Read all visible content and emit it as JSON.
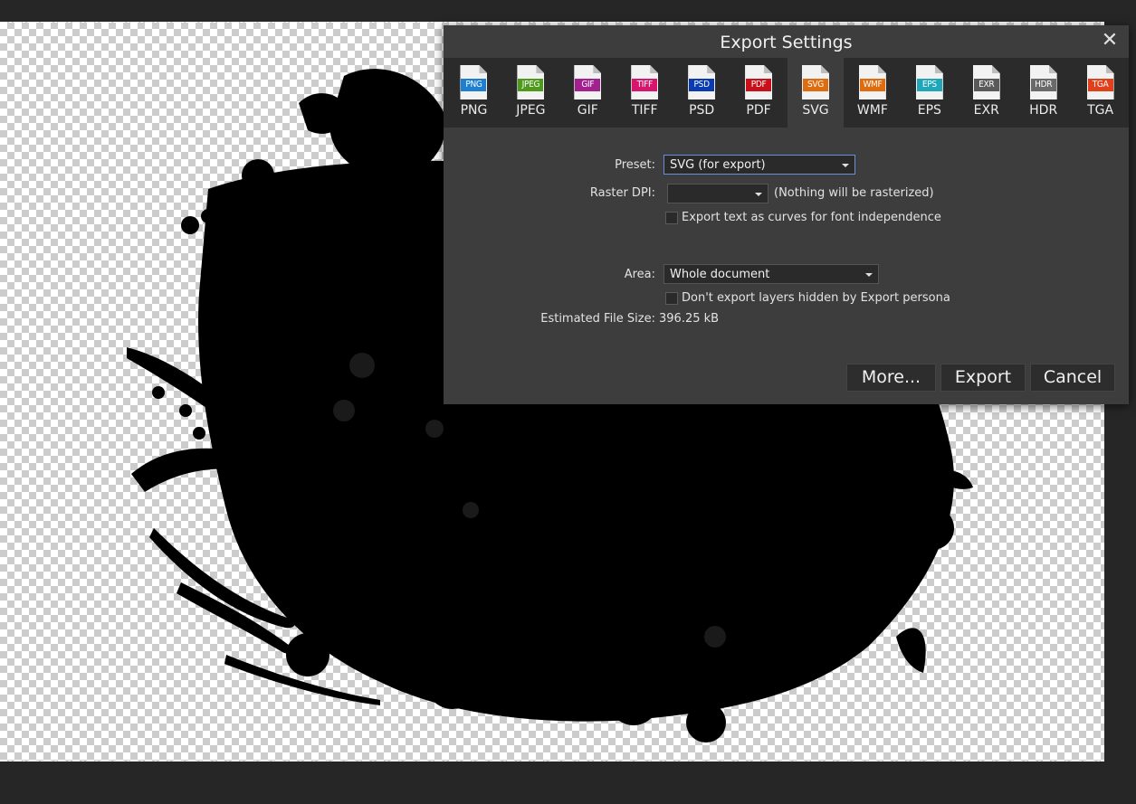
{
  "dialog": {
    "title": "Export Settings",
    "close_glyph": "✕"
  },
  "formats": [
    {
      "tag": "PNG",
      "label": "PNG",
      "color": "#1e7fd0",
      "selected": false
    },
    {
      "tag": "JPEG",
      "label": "JPEG",
      "color": "#4f9a1c",
      "selected": false
    },
    {
      "tag": "GIF",
      "label": "GIF",
      "color": "#a3208f",
      "selected": false
    },
    {
      "tag": "TIFF",
      "label": "TIFF",
      "color": "#d6156b",
      "selected": false
    },
    {
      "tag": "PSD",
      "label": "PSD",
      "color": "#0a3bb0",
      "selected": false
    },
    {
      "tag": "PDF",
      "label": "PDF",
      "color": "#c8101a",
      "selected": false
    },
    {
      "tag": "SVG",
      "label": "SVG",
      "color": "#e06c10",
      "selected": true
    },
    {
      "tag": "WMF",
      "label": "WMF",
      "color": "#e06c10",
      "selected": false
    },
    {
      "tag": "EPS",
      "label": "EPS",
      "color": "#1fa6b8",
      "selected": false
    },
    {
      "tag": "EXR",
      "label": "EXR",
      "color": "#5a5a5a",
      "selected": false
    },
    {
      "tag": "HDR",
      "label": "HDR",
      "color": "#6a6a6a",
      "selected": false
    },
    {
      "tag": "TGA",
      "label": "TGA",
      "color": "#e0401a",
      "selected": false
    }
  ],
  "settings": {
    "preset_label": "Preset:",
    "preset_value": "SVG (for export)",
    "raster_dpi_label": "Raster DPI:",
    "raster_dpi_value": "",
    "raster_dpi_note": "(Nothing will be rasterized)",
    "text_curves_label": "Export text as curves for font independence",
    "text_curves_checked": false,
    "area_label": "Area:",
    "area_value": "Whole document",
    "hidden_layers_label": "Don't export layers hidden by Export persona",
    "hidden_layers_checked": false,
    "file_size_label": "Estimated File Size:",
    "file_size_value": "396.25 kB"
  },
  "buttons": {
    "more": "More...",
    "export": "Export",
    "cancel": "Cancel"
  }
}
